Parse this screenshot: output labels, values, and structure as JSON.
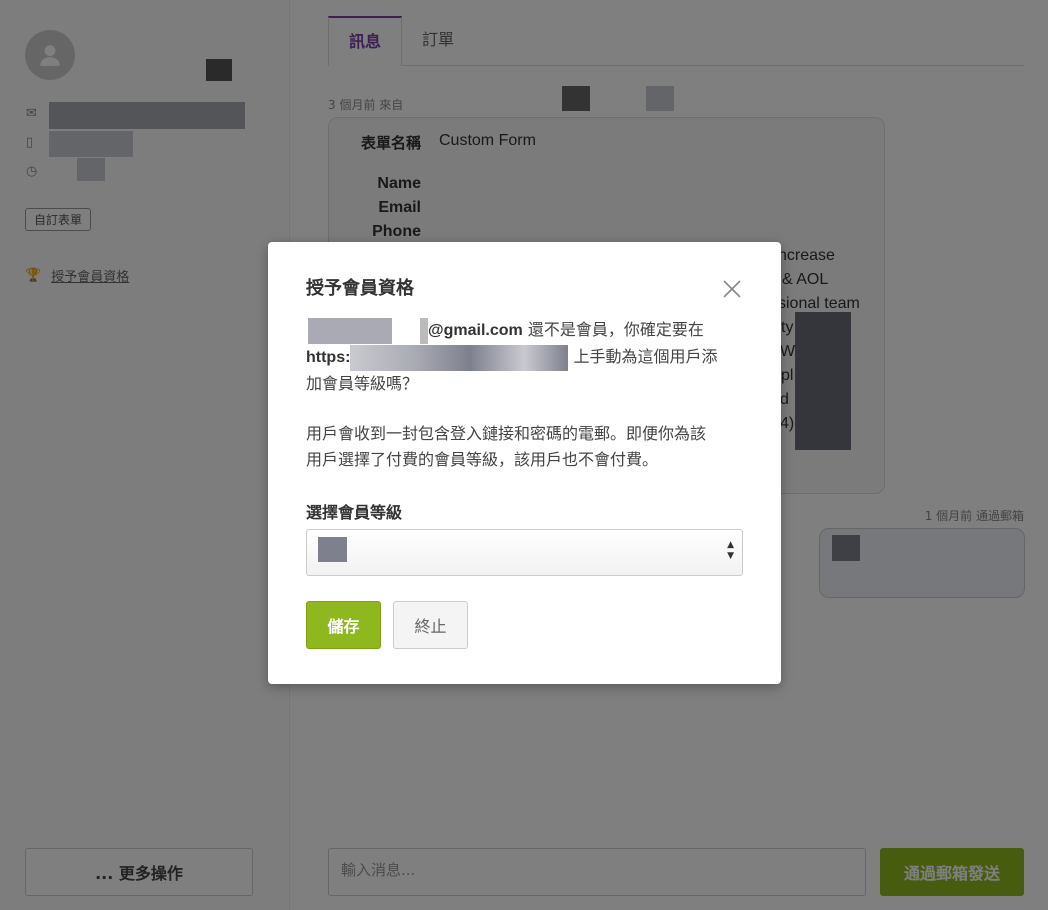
{
  "sidebar": {
    "tag": "自訂表單",
    "grant_link": "授予會員資格",
    "more_button": "... 更多操作"
  },
  "main": {
    "tabs": [
      {
        "label": "訊息",
        "active": true
      },
      {
        "label": "訂單",
        "active": false
      }
    ],
    "meta": "3 個月前 來自",
    "form": {
      "name_label": "表單名稱",
      "name_value": "Custom Form",
      "fields": [
        "Name",
        "Email",
        "Phone"
      ],
      "partial_lines": [
        "ncrease",
        "& AOL",
        "sional team",
        "ty",
        "We",
        "pl",
        "d",
        "4)"
      ]
    },
    "meta2": "1 個月前 通過郵箱",
    "input_placeholder": "輸入消息...",
    "send_button": "通過郵箱發送"
  },
  "modal": {
    "title": "授予會員資格",
    "email_suffix": "@gmail.com",
    "line1_rest": "還不是會員，你確定要在",
    "url_prefix": "https:",
    "line2_rest": "上手動為這個用戶添",
    "line3": "加會員等級嗎？",
    "para2_line1": "用戶會收到一封包含登入鏈接和密碼的電郵。即便你為該",
    "para2_line2": "用戶選擇了付費的會員等級，該用戶也不會付費。",
    "select_label": "選擇會員等級",
    "save_button": "儲存",
    "cancel_button": "終止"
  },
  "icons": {
    "close": "close-icon",
    "avatar": "user-icon",
    "mail": "mail-icon",
    "phone": "phone-icon",
    "clock": "clock-icon",
    "trophy": "trophy-icon"
  },
  "colors": {
    "accent_purple": "#7b3fa8",
    "button_green": "#8fb81f"
  }
}
